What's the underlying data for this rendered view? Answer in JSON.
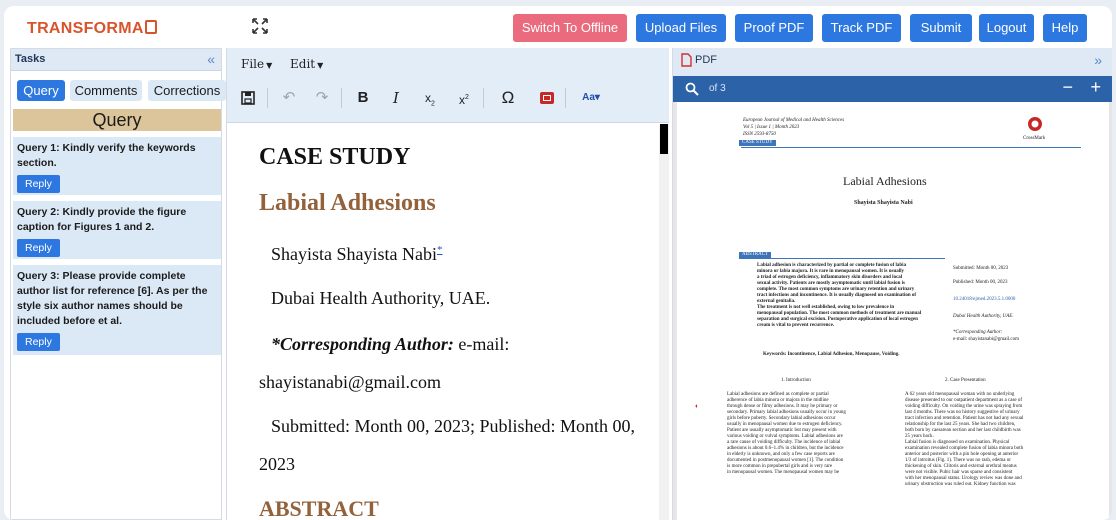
{
  "header": {
    "logo_text": "TRANSFORMA",
    "buttons": {
      "offline": "Switch To Offline",
      "upload": "Upload Files",
      "proof": "Proof PDF",
      "track": "Track PDF",
      "submit": "Submit",
      "logout": "Logout",
      "help": "Help"
    },
    "colors": {
      "primary": "#2d78e0",
      "danger": "#ea6b7d"
    }
  },
  "tasks": {
    "title": "Tasks",
    "tabs": [
      "Query",
      "Comments",
      "Corrections"
    ],
    "active_tab": "Query",
    "section_title": "Query",
    "queries": [
      {
        "text": "Query 1: Kindly verify the keywords section.",
        "reply_label": "Reply"
      },
      {
        "text": "Query 2: Kindly provide the figure caption for Figures 1 and 2.",
        "reply_label": "Reply"
      },
      {
        "text": "Query 3: Please provide complete author list for reference [6]. As per the style six author names should be included before et al.",
        "reply_label": "Reply"
      }
    ]
  },
  "editor": {
    "menus": {
      "file": "File",
      "edit": "Edit"
    },
    "toolbar_icons": [
      "save-icon",
      "undo-icon",
      "redo-icon",
      "bold-icon",
      "italic-icon",
      "subscript-icon",
      "superscript-icon",
      "omega-icon",
      "media-icon",
      "font-size-icon"
    ],
    "content": {
      "heading": "CASE STUDY",
      "title": "Labial Adhesions",
      "author": "Shayista Shayista Nabi",
      "author_mark": "*",
      "affiliation": "Dubai Health Authority, UAE.",
      "corr_label": "*Corresponding Author:",
      "corr_suffix": " e-mail:",
      "email": "shayistanabi@gmail.com",
      "dates_line1": "Submitted: Month 00, 2023; Published: Month 00,",
      "dates_line2": "2023",
      "abstract_heading": "ABSTRACT"
    }
  },
  "pdf": {
    "label": "PDF",
    "page_info": "of 3",
    "minus": "−",
    "plus": "+",
    "page": {
      "journal": "European Journal of Medical and Health Sciences",
      "volume": "Vol 5 | Issue 1 | Month 2023",
      "issn": "ISSN 2593-8750",
      "badge": "CASE STUDY",
      "publisher": "CrossMark",
      "title": "Labial Adhesions",
      "author": "Shayista Shayista Nabi",
      "abstract_label": "ABSTRACT",
      "abstract_lines": [
        "Labial adhesion is characterized by partial or complete fusion of labia",
        "minora or labia majora. It is rare in menopausal women. It is usually",
        "a triad of estrogen deficiency, inflammatory skin disorders and local",
        "sexual activity. Patients are mostly asymptomatic until labial fusion is",
        "complete. The most common symptoms are urinary retention and urinary",
        "tract infections and incontinence. It is usually diagnosed on examination of",
        "external genitalia.",
        "The treatment is not well established, owing to low prevalence in",
        "menopausal population. The most common methods of treatment are manual",
        "separation and surgical excision. Postoperative application of local estrogen",
        "cream is vital to prevent recurrence."
      ],
      "keywords": "Keywords: Incontinence, Labial Adhesion, Menopause, Voiding.",
      "side_submitted": "Submitted: Month 00, 2023",
      "side_published": "Published: Month 00, 2023",
      "side_doi": "10.24018/ejmed.2023.5.1.0000",
      "side_affiliation": "Dubai Health Authority, UAE.",
      "side_corr": "*Corresponding Author:",
      "side_email": "e-mail: shayistanabi@gmail.com",
      "section1": "1.  Introduction",
      "section2": "2.  Case Presentation",
      "col1_lines": [
        "Labial adhesions are defined as complete or partial",
        "adherence of labia minora or majora in the midline",
        "through dense or filmy adhesions. It may be primary or",
        "secondary. Primary labial adhesions usually occur in young",
        "girls before puberty. Secondary labial adhesions occur",
        "usually in menopausal women due to estrogen deficiency.",
        "Patient are usually asymptomatic but may present with",
        "various voiding or vulval symptoms. Labial adhesions are",
        "a rare cause of voiding difficulty. The incidence of labial",
        "adhesions is about 0.6–1.4% in children, but the incidence",
        "in elderly is unknown, and only a few case reports are",
        "documented in postmenopausal women [1]. The condition",
        "is more common in prepubertal girls and is very rare",
        "in menopausal women. The menopausal women may be"
      ],
      "col2_lines": [
        "A 62 years old menopausal woman with no underlying",
        "disease presented to our outpatient department as a case of",
        "voiding difficulty. On voiding the urine was spraying from",
        "last 4 months. There was no history suggestive of urinary",
        "tract infection and retention. Patient has not had any sexual",
        "relationship for the last 25 years. She had two children,",
        "both born by caesarean section and her last childbirth was",
        "25 years back.",
        "Labial fusion is diagnosed on examination. Physical",
        "examination revealed complete fusion of labia minora both",
        "anterior and posterior with a pin hole opening at anterior",
        "1/3 of introitus (Fig. 1). There was no rash, edema or",
        "thickening of skin. Clitoris and external urethral meatus",
        "were not visible. Pubic hair was sparse and consistent",
        "with her menopausal status. Urology review was done and",
        "urinary obstruction was ruled out. Kidney function was"
      ]
    }
  }
}
